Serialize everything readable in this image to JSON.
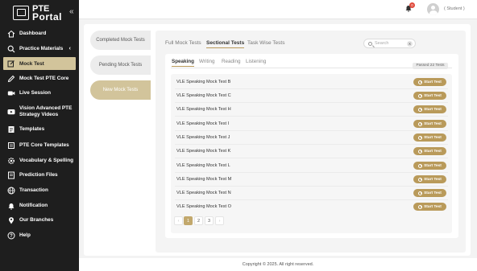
{
  "brand": {
    "line1": "PTE",
    "line2": "Portal",
    "collapse_glyph": "«"
  },
  "sidebar": {
    "items": [
      {
        "label": "Dashboard",
        "icon": "home-icon"
      },
      {
        "label": "Practice Materials",
        "icon": "search-icon",
        "caret": "‹"
      },
      {
        "label": "Mock Test",
        "icon": "edit-icon",
        "active": true
      },
      {
        "label": "Mock Test PTE Core",
        "icon": "pencil-icon"
      },
      {
        "label": "Live Session",
        "icon": "video-icon"
      },
      {
        "label": "Vision Advanced PTE Strategy Videos",
        "icon": "youtube-icon"
      },
      {
        "label": "Templates",
        "icon": "document-icon"
      },
      {
        "label": "PTE Core Templates",
        "icon": "folder-icon"
      },
      {
        "label": "Vocabulary & Spelling",
        "icon": "gear-icon"
      },
      {
        "label": "Prediction Files",
        "icon": "file-icon"
      },
      {
        "label": "Transaction",
        "icon": "globe-icon"
      },
      {
        "label": "Notification",
        "icon": "bell-icon"
      },
      {
        "label": "Our Branches",
        "icon": "map-pin-icon"
      },
      {
        "label": "Help",
        "icon": "help-icon"
      }
    ]
  },
  "topbar": {
    "notification_count": "0",
    "user_label": "( Student )"
  },
  "side_tabs": [
    "Completed Mock Tests",
    "Pending Mock Tests",
    "New Mock Tests"
  ],
  "top_tabs": [
    "Full Mock Tests",
    "Sectional Tests",
    "Task Wise Tests"
  ],
  "search": {
    "placeholder": "Search",
    "clear": "X"
  },
  "sub_tabs": [
    "Speaking",
    "Writing",
    "Reading",
    "Listening"
  ],
  "passed_label": "Passed 22 Tests",
  "tests": [
    "VLE Speaking Mock Test B",
    "VLE Speaking Mock Test C",
    "VLE Speaking Mock Test H",
    "VLE Speaking Mock Test I",
    "VLE Speaking Mock Test J",
    "VLE Speaking Mock Test K",
    "VLE Speaking Mock Test L",
    "VLE Speaking Mock Test M",
    "VLE Speaking Mock Test N",
    "VLE Speaking Mock Test O"
  ],
  "start_label": "Start Test",
  "pagination": {
    "prev": "‹",
    "pages": [
      "1",
      "2",
      "3"
    ],
    "next": "›",
    "current": "1"
  },
  "footer": "Copyright © 2025. All right reserved.",
  "colors": {
    "accent": "#b99a5a",
    "active_nav": "#d2c49b",
    "sidebar_bg": "#1e1e1e"
  }
}
